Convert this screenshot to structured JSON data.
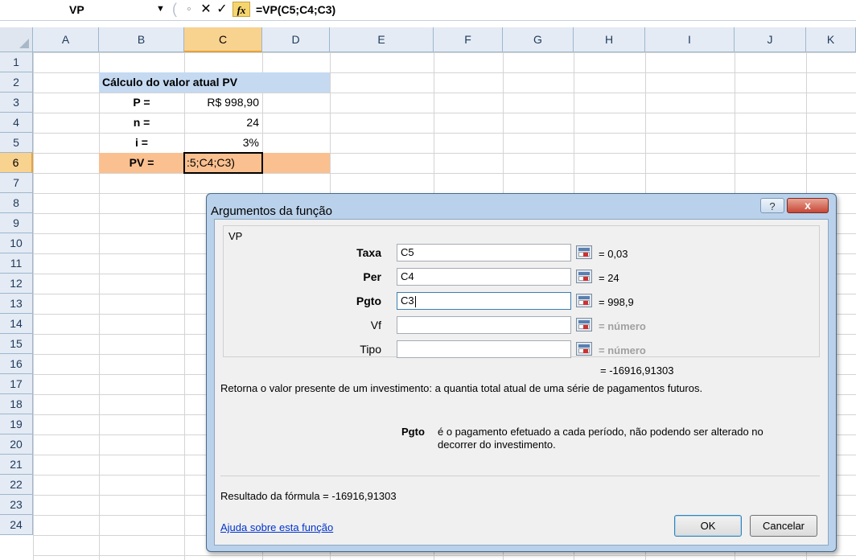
{
  "formula_bar": {
    "name_box": "VP",
    "name_box_arrow": "▼",
    "separator": "(",
    "cancel_glyph": "◦",
    "x_glyph": "✕",
    "check_glyph": "✓",
    "fx_label": "fx",
    "formula": "=VP(C5;C4;C3)"
  },
  "columns": [
    "A",
    "B",
    "C",
    "D",
    "E",
    "F",
    "G",
    "H",
    "I",
    "J",
    "K"
  ],
  "selected_column": "C",
  "rows": [
    "1",
    "2",
    "3",
    "4",
    "5",
    "6",
    "7",
    "8",
    "9",
    "10",
    "11",
    "12",
    "13",
    "14",
    "15",
    "16",
    "17",
    "18",
    "19",
    "20",
    "21",
    "22",
    "23",
    "24"
  ],
  "selected_row": "6",
  "cells": {
    "B2": "Cálculo do valor atual PV",
    "B3": "P =",
    "C3": "R$ 998,90",
    "B4": "n =",
    "C4": "24",
    "B5": "i =",
    "C5": "3%",
    "B6": "PV =",
    "C6": ":5;C4;C3)"
  },
  "colors": {
    "header_fill": "#c5d9f1",
    "pv_row_fill": "#fac090",
    "accent": "#e5a23b",
    "link": "#0033cc"
  },
  "dialog": {
    "title": "Argumentos da função",
    "help_glyph": "?",
    "close_glyph": "x",
    "function_name": "VP",
    "arguments": [
      {
        "label": "Taxa",
        "value": "C5",
        "result": "=  0,03",
        "bold": true
      },
      {
        "label": "Per",
        "value": "C4",
        "result": "=  24",
        "bold": true
      },
      {
        "label": "Pgto",
        "value": "C3",
        "result": "=  998,9",
        "bold": true
      },
      {
        "label": "Vf",
        "value": "",
        "result": "=  número",
        "bold": false
      },
      {
        "label": "Tipo",
        "value": "",
        "result": "=  número",
        "bold": false
      }
    ],
    "result_inline": "=  -16916,91303",
    "description": "Retorna o valor presente de um investimento: a quantia total atual de uma série de pagamentos futuros.",
    "arg_desc_name": "Pgto",
    "arg_desc_text": "é o pagamento efetuado a cada período, não podendo ser alterado no decorrer do investimento.",
    "formula_result_label": "Resultado da fórmula =   -16916,91303",
    "help_link": "Ajuda sobre esta função",
    "ok_label": "OK",
    "cancel_label": "Cancelar"
  }
}
